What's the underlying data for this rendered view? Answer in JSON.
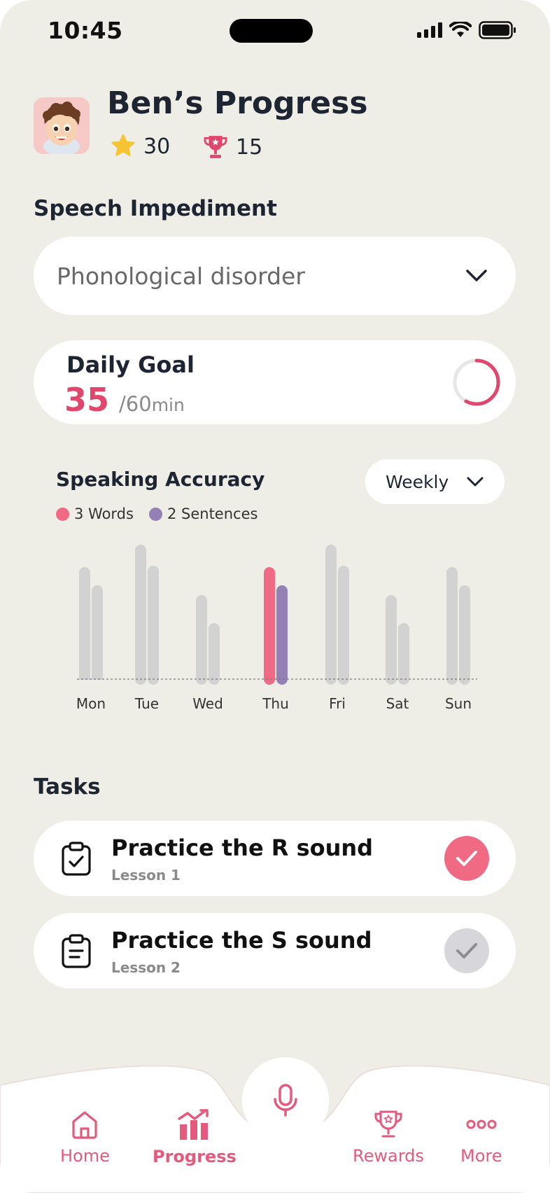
{
  "status_bar": {
    "time": "10:45"
  },
  "header": {
    "title": "Ben’s Progress",
    "stars": "30",
    "trophies": "15"
  },
  "impediment": {
    "label": "Speech Impediment",
    "selected": "Phonological disorder"
  },
  "daily_goal": {
    "title": "Daily Goal",
    "value": "35",
    "total": "/60",
    "unit": "min",
    "progress": 0.58
  },
  "accuracy": {
    "title": "Speaking Accuracy",
    "period": "Weekly",
    "legend": [
      "3 Words",
      "2 Sentences"
    ]
  },
  "colors": {
    "accent": "#F16A84",
    "secondary": "#9381B5",
    "inactive": "#D2D2D2"
  },
  "chart_data": {
    "type": "bar",
    "categories": [
      "Mon",
      "Tue",
      "Wed",
      "Thu",
      "Fri",
      "Sat",
      "Sun"
    ],
    "series": [
      {
        "name": "3 Words",
        "values": [
          80,
          96,
          60,
          80,
          96,
          60,
          80
        ]
      },
      {
        "name": "2 Sentences",
        "values": [
          67,
          81,
          40,
          67,
          81,
          40,
          67
        ]
      }
    ],
    "highlight": "Thu",
    "ylim": [
      0,
      100
    ],
    "grid": false
  },
  "tasks_label": "Tasks",
  "tasks": [
    {
      "title": "Practice the R sound",
      "subtitle": "Lesson 1",
      "done": true
    },
    {
      "title": "Practice the S sound",
      "subtitle": "Lesson 2",
      "done": false
    }
  ],
  "nav": {
    "home": "Home",
    "progress": "Progress",
    "rewards": "Rewards",
    "more": "More"
  }
}
